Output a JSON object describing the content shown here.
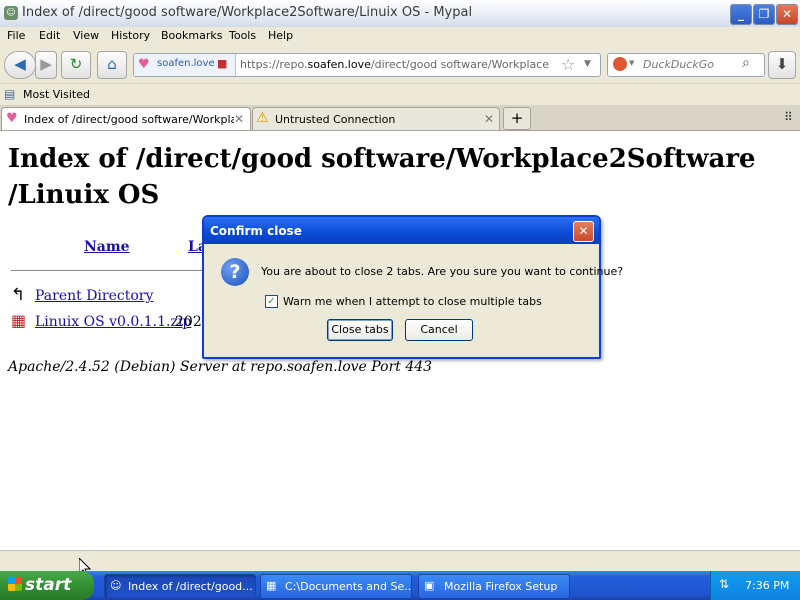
{
  "window": {
    "title": "Index of /direct/good software/Workplace2Software/Linuix OS - Mypal"
  },
  "menubar": {
    "items": [
      {
        "label": "File"
      },
      {
        "label": "Edit"
      },
      {
        "label": "View"
      },
      {
        "label": "History"
      },
      {
        "label": "Bookmarks"
      },
      {
        "label": "Tools"
      },
      {
        "label": "Help"
      }
    ]
  },
  "navbar": {
    "site_identity": "soafen.love",
    "url_prefix": "https://repo.",
    "url_domain": "soafen.love",
    "url_path": "/direct/good software/Workplace2Softwa",
    "search_placeholder": "DuckDuckGo"
  },
  "bookmarks": {
    "most_visited": "Most Visited"
  },
  "tabs": [
    {
      "label": "Index of /direct/good software/Workplac...",
      "selected": true
    },
    {
      "label": "Untrusted Connection",
      "selected": false
    }
  ],
  "page": {
    "heading": "Index of /direct/good software/Workplace2Software /Linuix OS",
    "col_name": "Name",
    "col_last_modified_partial": "La",
    "parent_directory": "Parent Directory",
    "file_name": "Linuix OS v0.0.1.1.zip",
    "file_date_partial": "202",
    "footer": "Apache/2.4.52 (Debian) Server at repo.soafen.love Port 443"
  },
  "dialog": {
    "title": "Confirm close",
    "message": "You are about to close 2 tabs. Are you sure you want to continue?",
    "checkbox_label": "Warn me when I attempt to close multiple tabs",
    "checkbox_checked": true,
    "primary_button": "Close tabs",
    "secondary_button": "Cancel"
  },
  "taskbar": {
    "start_label": "start",
    "tasks": [
      {
        "label": "Index of /direct/good...",
        "active": true
      },
      {
        "label": "C:\\Documents and Se...",
        "active": false
      },
      {
        "label": "Mozilla Firefox Setup",
        "active": false
      }
    ],
    "clock": "7:36 PM"
  },
  "colors": {
    "xp_blue": "#245edb",
    "start_green": "#2f8c2f",
    "dialog_border": "#0a3fd0",
    "link": "#1a0dab"
  }
}
